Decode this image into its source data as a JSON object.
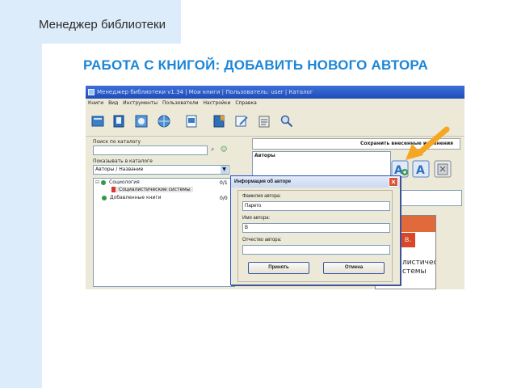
{
  "slide": {
    "subtitle": "Менеджер библиотеки",
    "title": "РАБОТА С КНИГОЙ: ДОБАВИТЬ НОВОГО АВТОРА",
    "accent_color": "#1c86d8",
    "panel_color": "#dcecfb"
  },
  "app": {
    "title": "Менеджер библиотеки v1.34 | Мои книги | Пользователь: user | Каталог",
    "menu": [
      "Книги",
      "Вид",
      "Инструменты",
      "Пользователи",
      "Настройки",
      "Справка"
    ],
    "toolbar_icons": [
      "books-icon",
      "book-icon",
      "catalog-icon",
      "globe-icon",
      "document-icon",
      "book-mark-icon",
      "edit-icon",
      "notes-icon",
      "search-icon"
    ],
    "search_label": "Поиск по каталогу",
    "search_value": "",
    "show_label": "Показывать в каталоге",
    "show_select": "Авторы / Название",
    "tree": [
      {
        "label": "Социология",
        "count": "0/1"
      },
      {
        "label": "Социалистические системы",
        "count": ""
      },
      {
        "label": "Добавленные книги",
        "count": "0/0"
      }
    ],
    "save_label": "Сохранить внесенные изменения",
    "authors_label": "Авторы",
    "cover_text_1": "рето в.",
    "cover_text_2": "листические",
    "cover_text_3": "стемы"
  },
  "dialog": {
    "title": "Информация об авторе",
    "lastname_label": "Фамилия автора:",
    "lastname_value": "Парето",
    "firstname_label": "Имя автора:",
    "firstname_value": "В",
    "patronymic_label": "Отчество автора:",
    "patronymic_value": "",
    "ok_label": "Принять",
    "cancel_label": "Отмена",
    "close_glyph": "×"
  },
  "arrow_color": "#f5a623"
}
